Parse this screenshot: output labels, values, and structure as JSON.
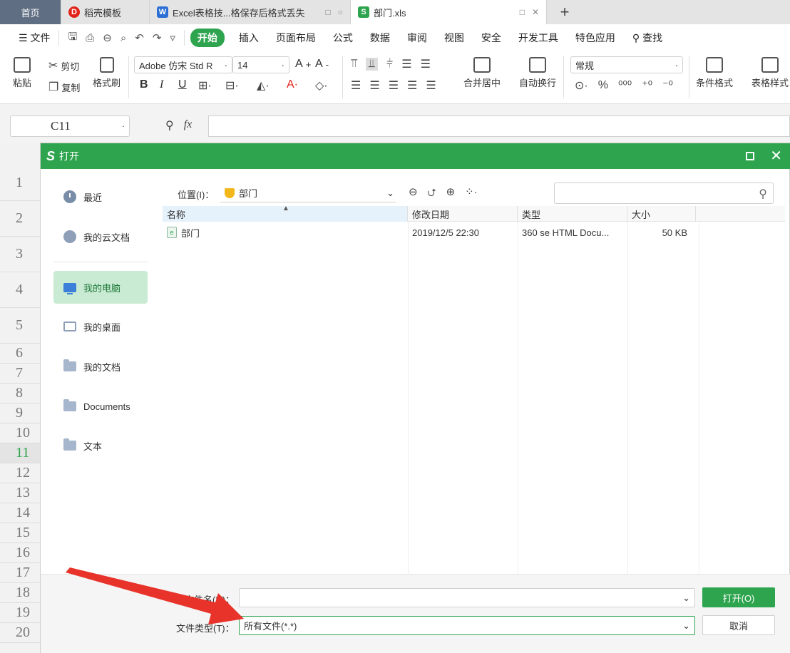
{
  "tabs": [
    {
      "label": "首页"
    },
    {
      "label": "稻壳模板",
      "icon": "D"
    },
    {
      "label": "Excel表格技...格保存后格式丢失",
      "icon": "W"
    },
    {
      "label": "部门.xls",
      "icon": "S"
    }
  ],
  "menu": {
    "file": "文件",
    "start": "开始",
    "insert": "插入",
    "layout": "页面布局",
    "formula": "公式",
    "data": "数据",
    "review": "审阅",
    "view": "视图",
    "security": "安全",
    "dev": "开发工具",
    "special": "特色应用",
    "search": "查找"
  },
  "tools": {
    "paste": "粘贴",
    "cut": "剪切",
    "copy": "复制",
    "format_painter": "格式刷",
    "font_name": "Adobe 仿宋 Std R",
    "font_size": "14",
    "merge": "合并居中",
    "wrap": "自动换行",
    "number_format": "常规",
    "cond_format": "条件格式",
    "table_style": "表格样式"
  },
  "formula_bar": {
    "cell_ref": "C11",
    "fx": "fx"
  },
  "row_numbers": [
    "1",
    "2",
    "3",
    "4",
    "5",
    "6",
    "7",
    "8",
    "9",
    "10",
    "11",
    "12",
    "13",
    "14",
    "15",
    "16",
    "17",
    "18",
    "19",
    "20"
  ],
  "dialog": {
    "title": "打开",
    "nav": [
      "最近",
      "我的云文档",
      "我的电脑",
      "我的桌面",
      "我的文档",
      "Documents",
      "文本"
    ],
    "location_label": "位置(I)：",
    "location_value": "部门",
    "columns": [
      "名称",
      "修改日期",
      "类型",
      "大小"
    ],
    "files": [
      {
        "name": "部门",
        "date": "2019/12/5 22:30",
        "type": "360 se HTML Docu...",
        "size": "50 KB"
      }
    ],
    "filename_label": "文件名(N)：",
    "filename_value": "",
    "filetype_label": "文件类型(T)：",
    "filetype_value": "所有文件(*.*)",
    "open_button": "打开(O)",
    "cancel_button": "取消"
  },
  "colors": {
    "accent": "#2ea44f",
    "arrow": "#e8332a"
  }
}
